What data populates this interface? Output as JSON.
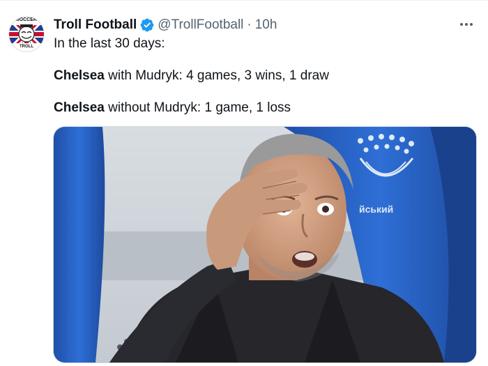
{
  "author": {
    "name": "Troll Football",
    "handle": "@TrollFootball",
    "separator": "·",
    "time": "10h",
    "avatar_text_top": "SOCCER",
    "avatar_text_bottom": "TROLL"
  },
  "tweet": {
    "line1": "In the last 30 days:",
    "line2_bold": "Chelsea",
    "line2_rest": " with Mudryk: 4 games, 3 wins, 1 draw",
    "line3_bold": "Chelsea",
    "line3_rest": " without Mudryk: 1 game, 1 loss"
  },
  "media": {
    "stadium_text": "йський"
  },
  "colors": {
    "verified": "#1d9bf0",
    "secondary_text": "#536471",
    "seat_blue": "#2a64c8"
  },
  "icons": [
    "verified-badge-icon",
    "more-options-icon"
  ]
}
